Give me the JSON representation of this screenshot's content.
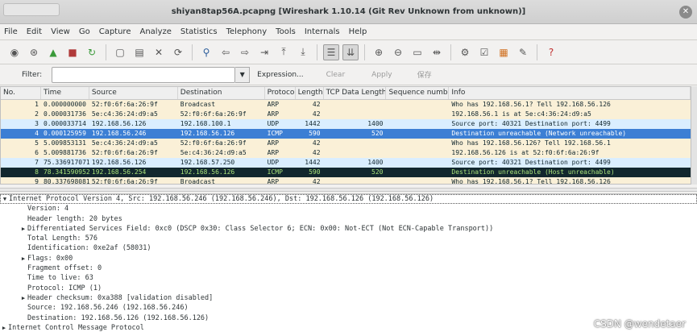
{
  "window": {
    "title": "shiyan8tap56A.pcapng   [Wireshark 1.10.14  (Git Rev Unknown from unknown)]",
    "close": "✕"
  },
  "menu": [
    "File",
    "Edit",
    "View",
    "Go",
    "Capture",
    "Analyze",
    "Statistics",
    "Telephony",
    "Tools",
    "Internals",
    "Help"
  ],
  "toolbar_icons": [
    "interface-list",
    "capture-options",
    "start-capture",
    "stop-capture",
    "restart-capture",
    "open-file",
    "save-file",
    "close-file",
    "reload-file",
    "find-packet",
    "go-back",
    "go-forward",
    "go-to-packet",
    "go-first",
    "go-last",
    "colorize",
    "auto-scroll",
    "zoom-in",
    "zoom-out",
    "normal-size",
    "resize-columns",
    "capture-filters",
    "display-filters",
    "coloring-rules",
    "preferences",
    "help"
  ],
  "filter": {
    "label": "Filter:",
    "value": "",
    "expression": "Expression...",
    "clear": "Clear",
    "apply": "Apply",
    "save": "保存"
  },
  "columns": [
    "No.",
    "Time",
    "Source",
    "Destination",
    "Protoco",
    "Length",
    "TCP Data Length",
    "Sequence numbe",
    "Info"
  ],
  "packets": [
    {
      "no": "1",
      "time": "0.000000000",
      "src": "52:f0:6f:6a:26:9f",
      "dst": "Broadcast",
      "proto": "ARP",
      "len": "42",
      "tcp": "",
      "seq": "",
      "info": "Who has 192.168.56.1?  Tell 192.168.56.126",
      "bg": "#faf0d7",
      "fg": "#12272e"
    },
    {
      "no": "2",
      "time": "0.000031736",
      "src": "5e:c4:36:24:d9:a5",
      "dst": "52:f0:6f:6a:26:9f",
      "proto": "ARP",
      "len": "42",
      "tcp": "",
      "seq": "",
      "info": "192.168.56.1 is at 5e:c4:36:24:d9:a5",
      "bg": "#faf0d7",
      "fg": "#12272e"
    },
    {
      "no": "3",
      "time": "0.000033714",
      "src": "192.168.56.126",
      "dst": "192.168.100.1",
      "proto": "UDP",
      "len": "1442",
      "tcp": "1400",
      "seq": "",
      "info": "Source port: 40321  Destination port: 4499",
      "bg": "#daeeff",
      "fg": "#12272e"
    },
    {
      "no": "4",
      "time": "0.000125959",
      "src": "192.168.56.246",
      "dst": "192.168.56.126",
      "proto": "ICMP",
      "len": "590",
      "tcp": "520",
      "seq": "",
      "info": "Destination unreachable (Network unreachable)",
      "bg": "#3c7fd4",
      "fg": "#ffffff"
    },
    {
      "no": "5",
      "time": "5.009853131",
      "src": "5e:c4:36:24:d9:a5",
      "dst": "52:f0:6f:6a:26:9f",
      "proto": "ARP",
      "len": "42",
      "tcp": "",
      "seq": "",
      "info": "Who has 192.168.56.126?  Tell 192.168.56.1",
      "bg": "#faf0d7",
      "fg": "#12272e"
    },
    {
      "no": "6",
      "time": "5.009881736",
      "src": "52:f0:6f:6a:26:9f",
      "dst": "5e:c4:36:24:d9:a5",
      "proto": "ARP",
      "len": "42",
      "tcp": "",
      "seq": "",
      "info": "192.168.56.126 is at 52:f0:6f:6a:26:9f",
      "bg": "#faf0d7",
      "fg": "#12272e"
    },
    {
      "no": "7",
      "time": "75.336917071",
      "src": "192.168.56.126",
      "dst": "192.168.57.250",
      "proto": "UDP",
      "len": "1442",
      "tcp": "1400",
      "seq": "",
      "info": "Source port: 40321  Destination port: 4499",
      "bg": "#daeeff",
      "fg": "#12272e"
    },
    {
      "no": "8",
      "time": "78.341590952",
      "src": "192.168.56.254",
      "dst": "192.168.56.126",
      "proto": "ICMP",
      "len": "590",
      "tcp": "520",
      "seq": "",
      "info": "Destination unreachable (Host unreachable)",
      "bg": "#12272e",
      "fg": "#a8e07a"
    },
    {
      "no": "9",
      "time": "80.337698081",
      "src": "52:f0:6f:6a:26:9f",
      "dst": "Broadcast",
      "proto": "ARP",
      "len": "42",
      "tcp": "",
      "seq": "",
      "info": "Who has 192.168.56.1?  Tell 192.168.56.126",
      "bg": "#faf0d7",
      "fg": "#12272e"
    }
  ],
  "details": [
    {
      "arrow": "▼",
      "indent": 0,
      "text": "Internet Protocol Version 4, Src: 192.168.56.246 (192.168.56.246), Dst: 192.168.56.126 (192.168.56.126)",
      "top": true
    },
    {
      "arrow": "",
      "indent": 1,
      "text": "Version: 4"
    },
    {
      "arrow": "",
      "indent": 1,
      "text": "Header length: 20 bytes"
    },
    {
      "arrow": "▶",
      "indent": 1,
      "text": "Differentiated Services Field: 0xc0 (DSCP 0x30: Class Selector 6; ECN: 0x00: Not-ECT (Not ECN-Capable Transport))"
    },
    {
      "arrow": "",
      "indent": 1,
      "text": "Total Length: 576"
    },
    {
      "arrow": "",
      "indent": 1,
      "text": "Identification: 0xe2af (58031)"
    },
    {
      "arrow": "▶",
      "indent": 1,
      "text": "Flags: 0x00"
    },
    {
      "arrow": "",
      "indent": 1,
      "text": "Fragment offset: 0"
    },
    {
      "arrow": "",
      "indent": 1,
      "text": "Time to live: 63"
    },
    {
      "arrow": "",
      "indent": 1,
      "text": "Protocol: ICMP (1)"
    },
    {
      "arrow": "▶",
      "indent": 1,
      "text": "Header checksum: 0xa388 [validation disabled]"
    },
    {
      "arrow": "",
      "indent": 1,
      "text": "Source: 192.168.56.246 (192.168.56.246)"
    },
    {
      "arrow": "",
      "indent": 1,
      "text": "Destination: 192.168.56.126 (192.168.56.126)"
    },
    {
      "arrow": "▶",
      "indent": 0,
      "text": "Internet Control Message Protocol"
    }
  ],
  "watermark": "CSDN @wendetaer"
}
